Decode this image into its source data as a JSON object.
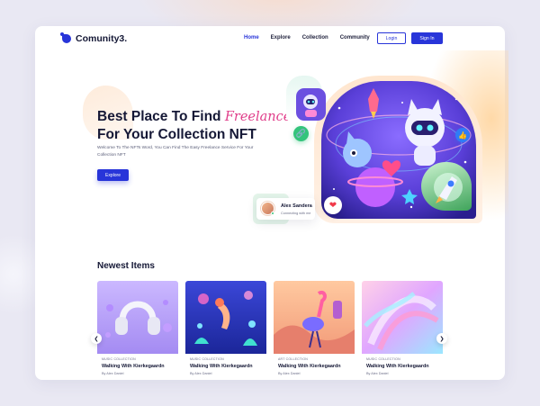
{
  "header": {
    "logo": "Comunity3.",
    "nav": [
      "Home",
      "Explore",
      "Collection",
      "Community"
    ],
    "active_nav": "Home",
    "login_label": "Login",
    "signin_label": "Sign In"
  },
  "hero": {
    "title_line1_prefix": "Best Place To Find ",
    "title_accent": "Freelance",
    "title_line2": "For Your Collection NFT",
    "description": "Welcome To The NFTs Word, You Can Find The Easy Freelance Service For Your Collection NFT",
    "cta_label": "Explore",
    "user_card": {
      "name": "Alex Sandera",
      "status": "Connecting with me"
    }
  },
  "newest": {
    "title": "Newest Items",
    "items": [
      {
        "tag": "Music Collection",
        "title": "Walking With Kierkegaardn",
        "author": "By Alex Daniel"
      },
      {
        "tag": "Music Collection",
        "title": "Walking With Kierkegaardn",
        "author": "By Alex Daniel"
      },
      {
        "tag": "Art Collection",
        "title": "Walking With Kierkegaardn",
        "author": "By Alex Daniel"
      },
      {
        "tag": "Music Collection",
        "title": "Walking With Kierkegaardn",
        "author": "By Alex Daniel"
      }
    ]
  },
  "colors": {
    "brand": "#2835d9",
    "accent": "#e03e8a",
    "text_dark": "#151836",
    "page_bg": "#e9e8f3"
  },
  "icons": [
    "logo-mark-icon",
    "link-icon",
    "thumbs-up-icon",
    "heart-icon",
    "chevron-left-icon",
    "chevron-right-icon"
  ]
}
